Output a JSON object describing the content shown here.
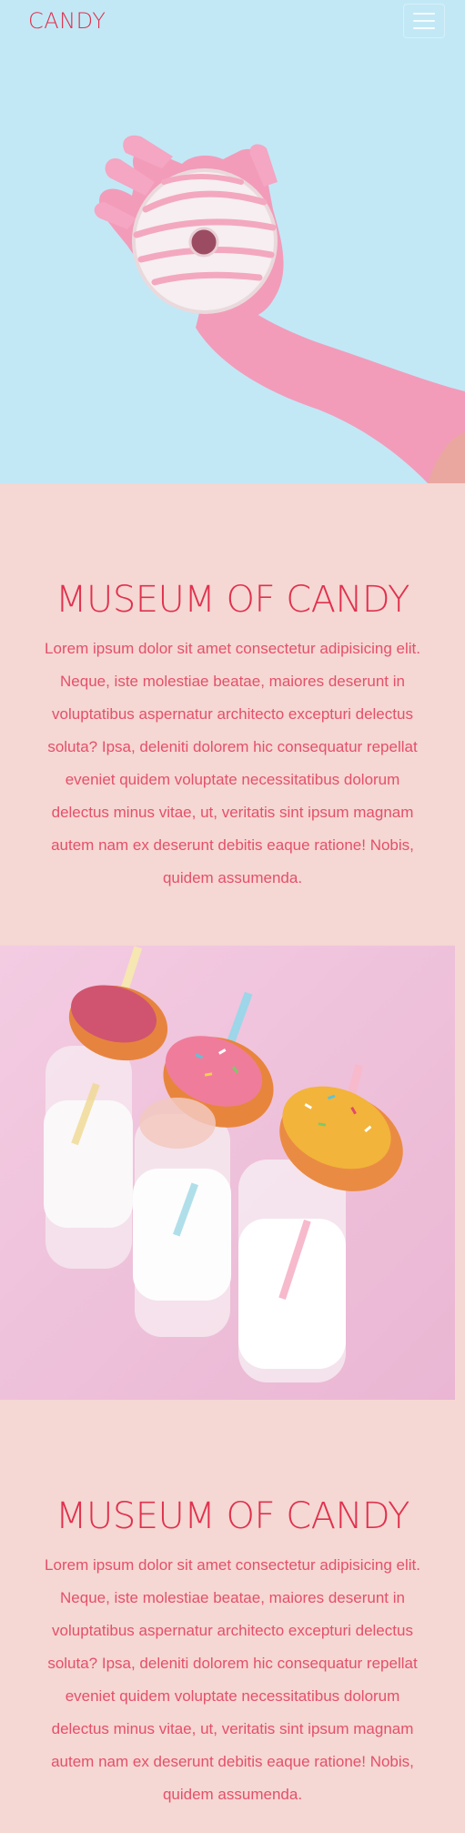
{
  "navbar": {
    "brand": "CANDY",
    "menu_icon": "hamburger-menu-icon"
  },
  "hero": {
    "image": "hand-in-pink-glove-holding-frosted-donut",
    "background_color": "#c2e8f6"
  },
  "sections": [
    {
      "title": "MUSEUM OF CANDY",
      "body": "Lorem ipsum dolor sit amet consectetur adipisicing elit. Neque, iste molestiae beatae, maiores deserunt in voluptatibus aspernatur architecto excepturi delectus soluta? Ipsa, deleniti dolorem hic consequatur repellat eveniet quidem voluptate necessitatibus dolorum delectus minus vitae, ut, veritatis sint ipsum magnam autem nam ex deserunt debitis eaque ratione! Nobis, quidem assumenda."
    },
    {
      "title": "MUSEUM OF CANDY",
      "body": "Lorem ipsum dolor sit amet consectetur adipisicing elit. Neque, iste molestiae beatae, maiores deserunt in voluptatibus aspernatur architecto excepturi delectus soluta? Ipsa, deleniti dolorem hic consequatur repellat eveniet quidem voluptate necessitatibus dolorum delectus minus vitae, ut, veritatis sint ipsum magnam autem nam ex deserunt debitis eaque ratione! Nobis, quidem assumenda."
    }
  ],
  "photo": {
    "image": "milk-bottles-with-donuts-and-striped-straws",
    "background_color": "#f2c7dd"
  },
  "colors": {
    "accent": "#e0314d",
    "page_background": "#f5d7d3"
  }
}
